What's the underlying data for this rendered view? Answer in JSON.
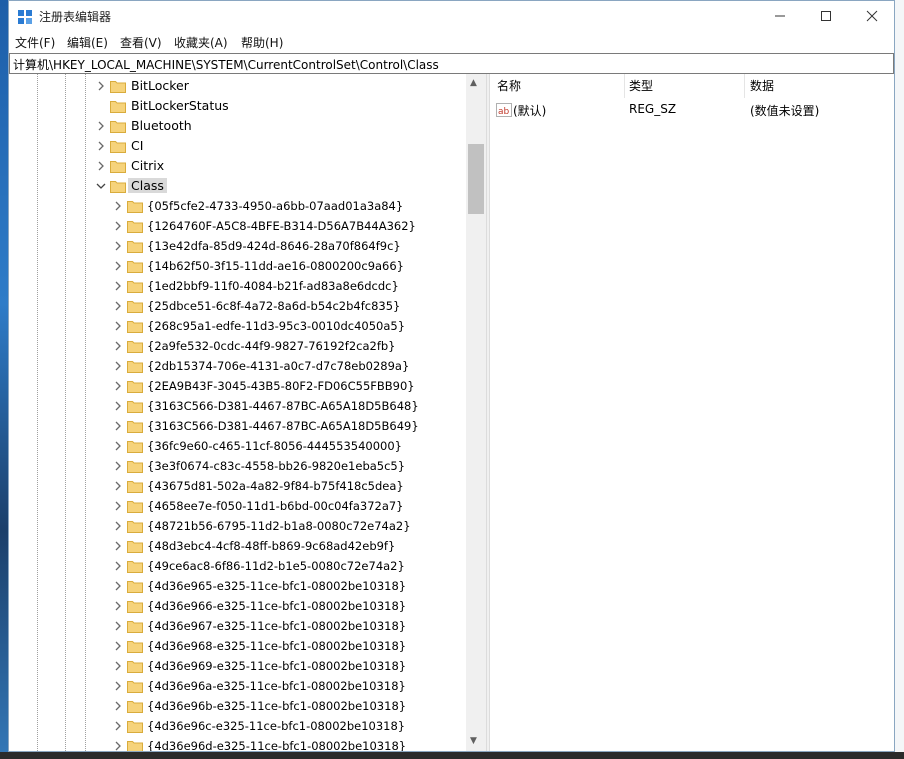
{
  "window": {
    "title": "注册表编辑器"
  },
  "menu": [
    "文件(F)",
    "编辑(E)",
    "查看(V)",
    "收藏夹(A)",
    "帮助(H)"
  ],
  "address": "计算机\\HKEY_LOCAL_MACHINE\\SYSTEM\\CurrentControlSet\\Control\\Class",
  "tree": {
    "siblings": [
      {
        "label": "BitLocker",
        "expander": "collapsed"
      },
      {
        "label": "BitLockerStatus",
        "expander": "none"
      },
      {
        "label": "Bluetooth",
        "expander": "collapsed"
      },
      {
        "label": "CI",
        "expander": "collapsed"
      },
      {
        "label": "Citrix",
        "expander": "collapsed"
      },
      {
        "label": "Class",
        "expander": "expanded",
        "selected": true
      }
    ],
    "children": [
      "{05f5cfe2-4733-4950-a6bb-07aad01a3a84}",
      "{1264760F-A5C8-4BFE-B314-D56A7B44A362}",
      "{13e42dfa-85d9-424d-8646-28a70f864f9c}",
      "{14b62f50-3f15-11dd-ae16-0800200c9a66}",
      "{1ed2bbf9-11f0-4084-b21f-ad83a8e6dcdc}",
      "{25dbce51-6c8f-4a72-8a6d-b54c2b4fc835}",
      "{268c95a1-edfe-11d3-95c3-0010dc4050a5}",
      "{2a9fe532-0cdc-44f9-9827-76192f2ca2fb}",
      "{2db15374-706e-4131-a0c7-d7c78eb0289a}",
      "{2EA9B43F-3045-43B5-80F2-FD06C55FBB90}",
      "{3163C566-D381-4467-87BC-A65A18D5B648}",
      "{3163C566-D381-4467-87BC-A65A18D5B649}",
      "{36fc9e60-c465-11cf-8056-444553540000}",
      "{3e3f0674-c83c-4558-bb26-9820e1eba5c5}",
      "{43675d81-502a-4a82-9f84-b75f418c5dea}",
      "{4658ee7e-f050-11d1-b6bd-00c04fa372a7}",
      "{48721b56-6795-11d2-b1a8-0080c72e74a2}",
      "{48d3ebc4-4cf8-48ff-b869-9c68ad42eb9f}",
      "{49ce6ac8-6f86-11d2-b1e5-0080c72e74a2}",
      "{4d36e965-e325-11ce-bfc1-08002be10318}",
      "{4d36e966-e325-11ce-bfc1-08002be10318}",
      "{4d36e967-e325-11ce-bfc1-08002be10318}",
      "{4d36e968-e325-11ce-bfc1-08002be10318}",
      "{4d36e969-e325-11ce-bfc1-08002be10318}",
      "{4d36e96a-e325-11ce-bfc1-08002be10318}",
      "{4d36e96b-e325-11ce-bfc1-08002be10318}",
      "{4d36e96c-e325-11ce-bfc1-08002be10318}",
      "{4d36e96d-e325-11ce-bfc1-08002be10318}"
    ]
  },
  "details": {
    "columns": [
      "名称",
      "类型",
      "数据"
    ],
    "rows": [
      {
        "icon": "string-value-icon",
        "name": "(默认)",
        "type": "REG_SZ",
        "data": "(数值未设置)"
      }
    ]
  },
  "colors": {
    "folder": "#f6d37b",
    "folder_edge": "#d9ac3c",
    "selection": "#d9d9d9"
  }
}
